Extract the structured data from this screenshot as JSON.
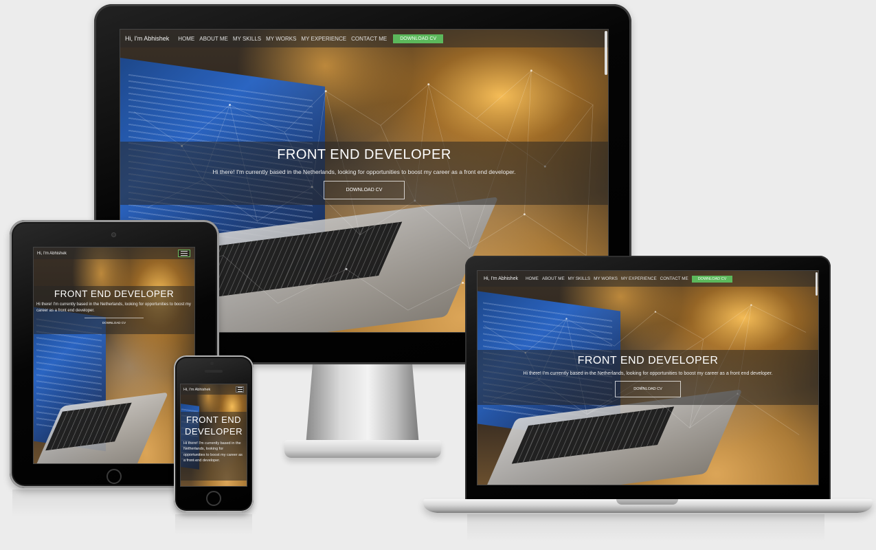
{
  "site": {
    "brand": "Hi, I'm Abhishek",
    "nav": [
      "HOME",
      "ABOUT ME",
      "MY SKILLS",
      "MY WORKS",
      "MY EXPERIENCE",
      "CONTACT ME"
    ],
    "download_cv_nav": "DOWNLOAD CV",
    "hero_title": "FRONT END DEVELOPER",
    "hero_subtitle": "Hi there! I'm currently based in the Netherlands, looking for opportunities to boost my career as a front end developer.",
    "hero_button": "DOWNLOAD CV"
  },
  "colors": {
    "download_cv_green": "#5cb85c",
    "background": "#ececec",
    "device_black": "#000000"
  }
}
